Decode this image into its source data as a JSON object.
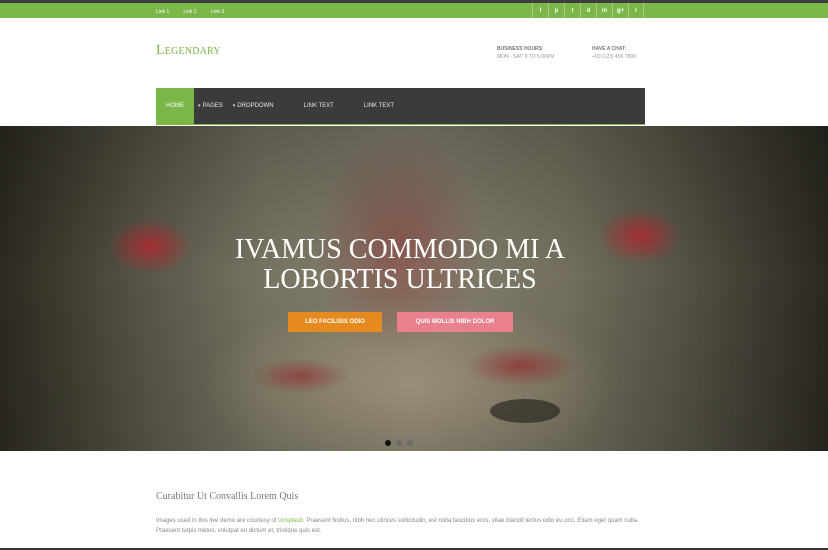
{
  "topbar": {
    "links": [
      "Link 1",
      "Link 2",
      "Link 3"
    ],
    "social_icons": [
      "facebook-icon",
      "pinterest-icon",
      "twitter-icon",
      "dribbble-icon",
      "linkedin-icon",
      "google-plus-icon",
      "rss-icon"
    ],
    "social_glyphs": [
      "f",
      "p",
      "t",
      "d",
      "in",
      "g+",
      "r"
    ],
    "color": "#7ab648"
  },
  "header": {
    "logo": "Legendary",
    "hours_heading": "BUSINESS HOURS:",
    "hours_value": "MON - SAT: 9 TO 5:00PM",
    "chat_heading": "HAVE A CHAT:",
    "chat_value": "+00 (123) 456 7890"
  },
  "nav": {
    "items": [
      {
        "label": "HOME",
        "active": true
      },
      {
        "label": "PAGES",
        "dropdown": true
      },
      {
        "label": "DROPDOWN",
        "dropdown": true
      },
      {
        "label": "LINK TEXT"
      },
      {
        "label": "LINK TEXT"
      }
    ]
  },
  "hero": {
    "title_line1": "IVAMUS COMMODO MI A",
    "title_line2": "LOBORTIS ULTRICES",
    "primary_button": "LEO FACILISIS ODIO",
    "secondary_button": "QUIS MOLLIS NIBH DOLOR",
    "primary_color": "#e58a1f",
    "secondary_color": "#e8808e",
    "slides": 3,
    "active_slide": 1
  },
  "content": {
    "heading": "Curabitur Ut Convallis Lorem Quis",
    "text_before_link": "Images used in this live demo are courtesy of ",
    "link": "Unsplash",
    "text_after_link": ". Praesent finibus, nibh nec ultrices sollicitudin, est nulla faucibus eros, vitae blandit lectus odio eu orci. Etiam eget quam nulla. Praesent turpis metus, volutpat eu dictum et, tristique quis est."
  }
}
